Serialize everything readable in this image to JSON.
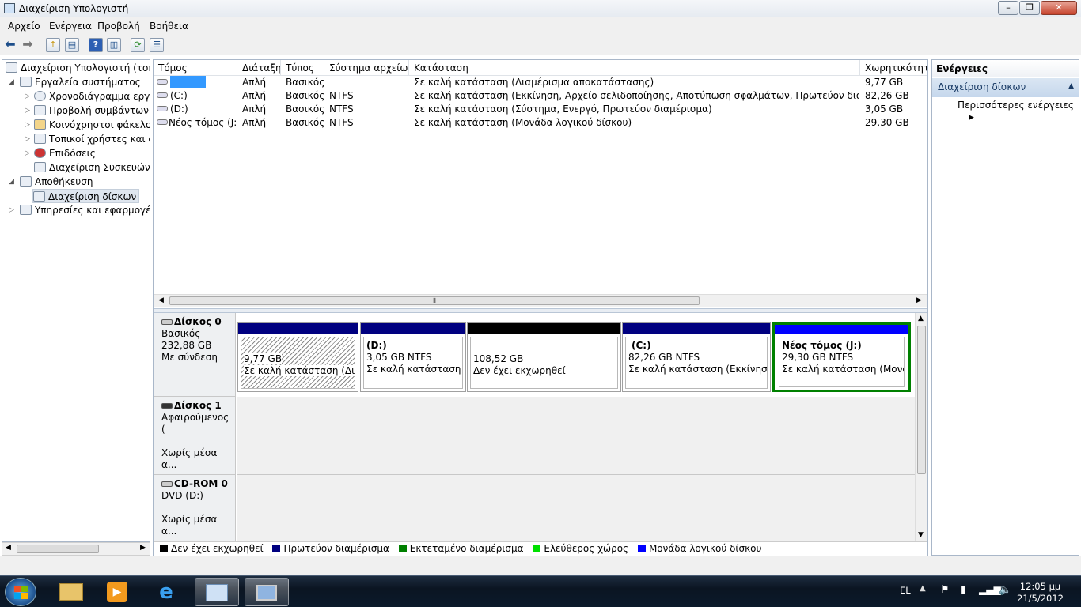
{
  "window": {
    "title": "Διαχείριση Υπολογιστή"
  },
  "menu": [
    "Αρχείο",
    "Ενέργεια",
    "Προβολή",
    "Βοήθεια"
  ],
  "tree": {
    "root": "Διαχείριση Υπολογιστή (τοπικ",
    "system_tools": "Εργαλεία συστήματος",
    "task_scheduler": "Χρονοδιάγραμμα εργασ",
    "event_viewer": "Προβολή συμβάντων",
    "shared_folders": "Κοινόχρηστοι φάκελοι",
    "local_users": "Τοπικοί χρήστες και ομ",
    "performance": "Επιδόσεις",
    "device_manager": "Διαχείριση Συσκευών",
    "storage": "Αποθήκευση",
    "disk_management": "Διαχείριση δίσκων",
    "services": "Υπηρεσίες και εφαρμογές"
  },
  "volumes": {
    "columns": [
      "Τόμος",
      "Διάταξη",
      "Τύπος",
      "Σύστημα αρχείων",
      "Κατάσταση",
      "Χωρητικότητα"
    ],
    "rows": [
      {
        "name": "",
        "layout": "Απλή",
        "type": "Βασικός",
        "fs": "",
        "status": "Σε καλή κατάσταση (Διαμέρισμα αποκατάστασης)",
        "capacity": "9,77 GB"
      },
      {
        "name": "(C:)",
        "layout": "Απλή",
        "type": "Βασικός",
        "fs": "NTFS",
        "status": "Σε καλή κατάσταση (Εκκίνηση, Αρχείο σελιδοποίησης, Αποτύπωση σφαλμάτων, Πρωτεύον διαμέρισμα)",
        "capacity": "82,26 GB"
      },
      {
        "name": "(D:)",
        "layout": "Απλή",
        "type": "Βασικός",
        "fs": "NTFS",
        "status": "Σε καλή κατάσταση (Σύστημα, Ενεργό, Πρωτεύον διαμέρισμα)",
        "capacity": "3,05 GB"
      },
      {
        "name": "Νέος τόμος (J:)",
        "layout": "Απλή",
        "type": "Βασικός",
        "fs": "NTFS",
        "status": "Σε καλή κατάσταση (Μονάδα λογικού δίσκου)",
        "capacity": "29,30 GB"
      }
    ]
  },
  "disks": {
    "disk0": {
      "name": "Δίσκος 0",
      "type": "Βασικός",
      "size": "232,88 GB",
      "status": "Με σύνδεση"
    },
    "disk1": {
      "name": "Δίσκος 1",
      "type": "Αφαιρούμενος (",
      "media": "Χωρίς μέσα α..."
    },
    "cdrom": {
      "name": "CD-ROM 0",
      "type": "DVD (D:)",
      "media": "Χωρίς μέσα α..."
    },
    "partitions": [
      {
        "title": "",
        "size": "9,77 GB",
        "status": "Σε καλή κατάσταση (Διαμέ"
      },
      {
        "title": "(D:)",
        "size": "3,05 GB NTFS",
        "status": "Σε καλή κατάσταση (Σι"
      },
      {
        "title": "",
        "size": "108,52 GB",
        "status": "Δεν έχει εκχωρηθεί"
      },
      {
        "title": "(C:)",
        "size": "82,26 GB NTFS",
        "status": "Σε καλή κατάσταση (Εκκίνηση, Αρ"
      },
      {
        "title": "Νέος τόμος  (J:)",
        "size": "29,30 GB NTFS",
        "status": "Σε καλή κατάσταση (Μονάδα"
      }
    ]
  },
  "legend": [
    {
      "label": "Δεν έχει εκχωρηθεί",
      "color": "#000000"
    },
    {
      "label": "Πρωτεύον διαμέρισμα",
      "color": "#000080"
    },
    {
      "label": "Εκτεταμένο διαμέρισμα",
      "color": "#008000"
    },
    {
      "label": "Ελεύθερος χώρος",
      "color": "#00e000"
    },
    {
      "label": "Μονάδα λογικού δίσκου",
      "color": "#0000ff"
    }
  ],
  "actions": {
    "header": "Ενέργειες",
    "section": "Διαχείριση δίσκων",
    "more": "Περισσότερες ενέργειες"
  },
  "taskbar": {
    "lang": "EL",
    "time": "12:05 μμ",
    "date": "21/5/2012"
  }
}
